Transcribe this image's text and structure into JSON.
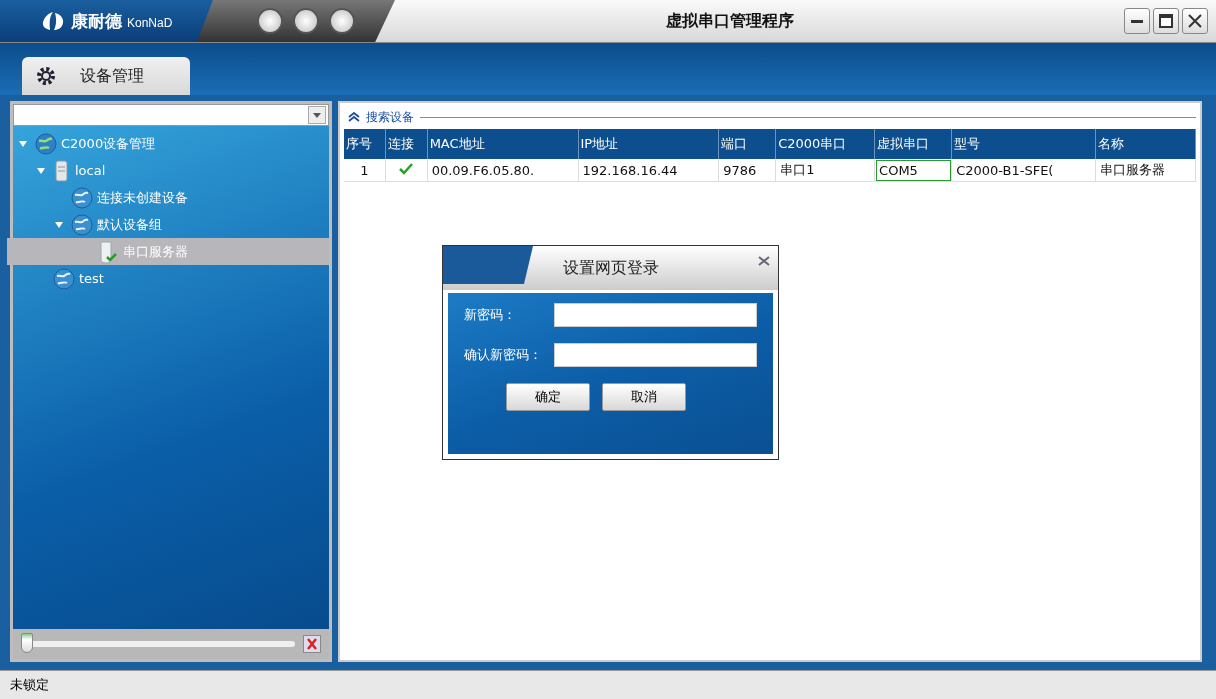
{
  "window": {
    "title": "虚拟串口管理程序",
    "logo_cn": "康耐德",
    "logo_en": "KonNaD"
  },
  "tabs": [
    {
      "label": "设备管理",
      "selected": true
    }
  ],
  "sidebar": {
    "tree": [
      {
        "label": "C2000设备管理",
        "kind": "root",
        "expanded": true,
        "selected": false,
        "children": [
          {
            "label": "local",
            "kind": "server",
            "expanded": true,
            "selected": false,
            "children": [
              {
                "label": "连接未创建设备",
                "kind": "group",
                "selected": false
              },
              {
                "label": "默认设备组",
                "kind": "group",
                "expanded": true,
                "selected": false,
                "children": [
                  {
                    "label": "串口服务器",
                    "kind": "device",
                    "selected": true
                  }
                ]
              }
            ]
          },
          {
            "label": "test",
            "kind": "group",
            "selected": false
          }
        ]
      }
    ],
    "slider": {
      "level": 0
    }
  },
  "section": {
    "title": "搜索设备",
    "expanded": true
  },
  "table": {
    "columns": [
      "序号",
      "连接",
      "MAC地址",
      "IP地址",
      "端口",
      "C2000串口",
      "虚拟串口",
      "型号",
      "名称"
    ],
    "rows": [
      {
        "cells": [
          {
            "kind": "text",
            "text": "1",
            "focused": false
          },
          {
            "kind": "status",
            "connected": true,
            "focused": false
          },
          {
            "kind": "text",
            "text": "00.09.F6.05.80.",
            "focused": false
          },
          {
            "kind": "text",
            "text": "192.168.16.44",
            "focused": false
          },
          {
            "kind": "text",
            "text": "9786",
            "focused": false
          },
          {
            "kind": "text",
            "text": "串口1",
            "focused": false
          },
          {
            "kind": "text",
            "text": "COM5",
            "focused": true
          },
          {
            "kind": "text",
            "text": "C2000-B1-SFE(",
            "focused": false
          },
          {
            "kind": "text",
            "text": "串口服务器",
            "focused": false
          }
        ]
      }
    ]
  },
  "dialog": {
    "title": "设置网页登录",
    "fields": [
      {
        "label": "新密码："
      },
      {
        "label": "确认新密码："
      }
    ],
    "buttons": [
      "确定",
      "取消"
    ]
  },
  "status_bar": {
    "text": "未锁定"
  }
}
